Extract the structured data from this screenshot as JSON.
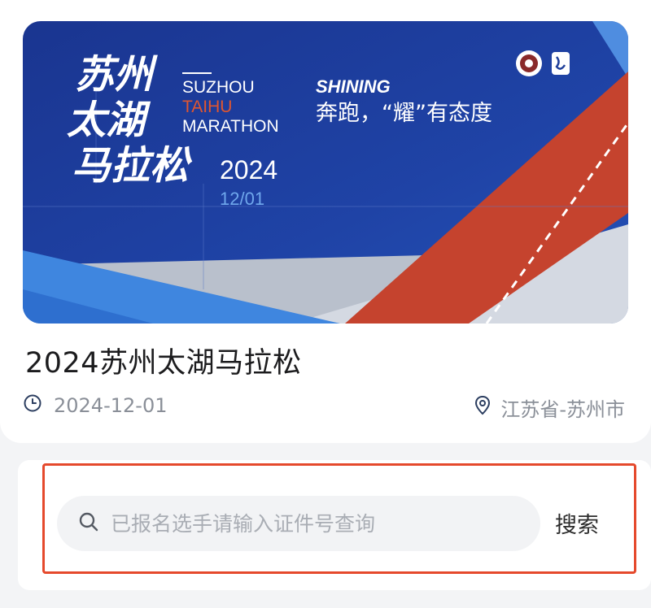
{
  "banner": {
    "title_cn": [
      "苏州",
      "太湖",
      "马拉松"
    ],
    "title_en": [
      "SUZHOU",
      "TAIHU",
      "MARATHON"
    ],
    "year": "2024",
    "date": "12/01",
    "slogan_en": "SHINING",
    "slogan_cn": "奔跑，“耀”有态度"
  },
  "event": {
    "title": "2024苏州太湖马拉松",
    "date": "2024-12-01",
    "location": "江苏省-苏州市"
  },
  "search": {
    "placeholder": "已报名选手请输入证件号查询",
    "button_label": "搜索"
  },
  "colors": {
    "banner_blue": "#1f3f9a",
    "track_red": "#c5432e",
    "highlight": "#e5492c"
  },
  "icons": [
    "clock-icon",
    "location-pin-icon",
    "search-icon",
    "organizer-logo-icon",
    "marathon-logo-icon"
  ]
}
